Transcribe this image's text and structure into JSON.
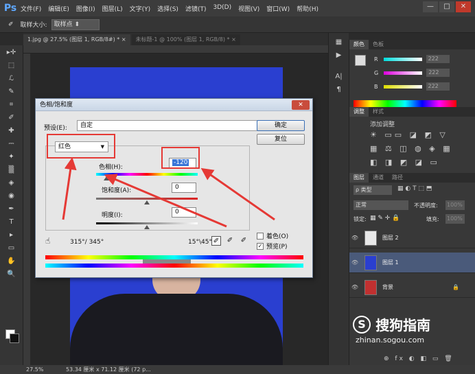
{
  "app": {
    "logo": "Ps",
    "menu": [
      "文件(F)",
      "编辑(E)",
      "图像(I)",
      "图层(L)",
      "文字(Y)",
      "选择(S)",
      "滤镜(T)",
      "3D(D)",
      "视图(V)",
      "窗口(W)",
      "帮助(H)"
    ],
    "window_controls": {
      "minimize": "—",
      "restore": "□",
      "close": "✕"
    }
  },
  "options_bar": {
    "tool_icon": "eyedropper-icon",
    "sample_size_label": "取样大小:",
    "sample_size_value": "取样点"
  },
  "document_tabs": [
    {
      "label": "1.jpg @ 27.5% (图层 1, RGB/8#) * ×",
      "active": true
    },
    {
      "label": "未标题-1 @ 100% (图层 1, RGB/8) * ×",
      "active": false
    }
  ],
  "toolbox_glyphs": [
    "▸✛",
    "⬚",
    "ℒ",
    "✎",
    "⌗",
    "✐",
    "✚",
    "⎓",
    "✦",
    "▒",
    "◈",
    "◉",
    "✒",
    "T",
    "▸",
    "▭",
    "✋",
    "🔍"
  ],
  "status_bar": {
    "zoom": "27.5%",
    "doc_info": "53.34 厘米 x 71.12 厘米 (72 p..."
  },
  "color_panel": {
    "tabs": [
      "颜色",
      "色板"
    ],
    "channels": [
      {
        "label": "R",
        "value": "222"
      },
      {
        "label": "G",
        "value": "222"
      },
      {
        "label": "B",
        "value": "222"
      }
    ]
  },
  "adjustments_panel": {
    "tabs": [
      "调整",
      "样式"
    ],
    "title": "添加调整",
    "icon_rows": [
      "☀ ▭▭ ◪ ◩ ▽",
      "▦ ⚖ ◫ ◍ ◈ ▦",
      "◧ ◨ ◩ ◪ ▭"
    ]
  },
  "layers_panel": {
    "tabs": [
      "图层",
      "通道",
      "路径"
    ],
    "filter_label": "ρ 类型",
    "blend_mode": "正常",
    "opacity_label": "不透明度:",
    "opacity_value": "100%",
    "lock_label": "锁定:",
    "fill_label": "填充:",
    "fill_value": "100%",
    "layers": [
      {
        "name": "图层 2",
        "thumb_color": "#e8e8e8",
        "selected": false
      },
      {
        "name": "图层 1",
        "thumb_color": "#2a3fd0",
        "selected": true
      },
      {
        "name": "背景",
        "thumb_color": "#c03030",
        "selected": false
      }
    ],
    "footer_icons": "⊕ fx ◐ ◧ ▭ 🗑"
  },
  "dialog": {
    "title": "色相/饱和度",
    "close": "✕",
    "preset_label": "预设(E):",
    "preset_value": "自定",
    "preset_arrow": "▼",
    "preset_icon": "⇶",
    "ok_label": "确定",
    "reset_label": "复位",
    "channel_value": "红色",
    "channel_arrow": "▼",
    "hue_label": "色相(H):",
    "hue_value": "-120",
    "saturation_label": "饱和度(A):",
    "saturation_value": "0",
    "lightness_label": "明度(I):",
    "lightness_value": "0",
    "colorize_label": "着色(O)",
    "preview_label": "预览(P)",
    "preview_checked": true,
    "colorize_checked": false,
    "range_left": "315°/ 345°",
    "range_right": "15°\\45°",
    "hue_position": 0.1,
    "saturation_position": 0.5,
    "lightness_position": 0.5
  },
  "watermark": {
    "logo": "S",
    "text": "搜狗指南",
    "url": "zhinan.sogou.com"
  },
  "colors": {
    "annotation": "#e53935",
    "photo_bg": "#2a3fd0",
    "accent": "#3875d7"
  }
}
